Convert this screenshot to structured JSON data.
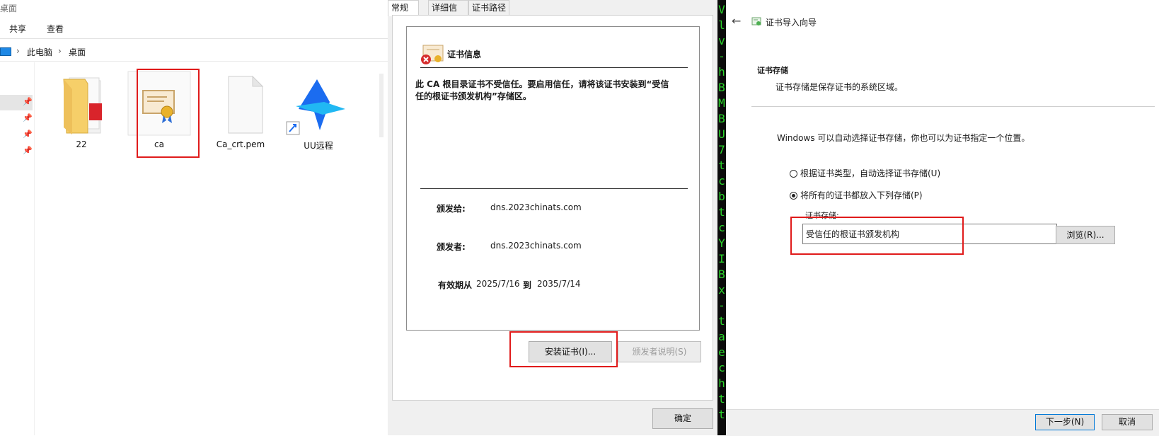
{
  "explorer": {
    "title": "桌面",
    "ribbon_tabs": [
      "共享",
      "查看"
    ],
    "breadcrumb": [
      "此电脑",
      "桌面"
    ],
    "files": [
      {
        "name": "22",
        "icon": "folder-icon"
      },
      {
        "name": "ca",
        "icon": "certificate-icon"
      },
      {
        "name": "Ca_crt.pem",
        "icon": "blank-file-icon"
      },
      {
        "name": "UU远程",
        "icon": "uu-remote-app-icon"
      }
    ]
  },
  "cert_dialog": {
    "tabs": [
      "常规",
      "详细信息",
      "证书路径"
    ],
    "heading": "证书信息",
    "warning_line1": "此 CA 根目录证书不受信任。要启用信任，请将该证书安装到“受信",
    "warning_line2": "任的根证书颁发机构”存储区。",
    "issued_to_label": "颁发给:",
    "issued_to_value": "dns.2023chinats.com",
    "issued_by_label": "颁发者:",
    "issued_by_value": "dns.2023chinats.com",
    "valid_from_label": "有效期从",
    "valid_from": "2025/7/16",
    "valid_to_label": "到",
    "valid_to": "2035/7/14",
    "install_button": "安装证书(I)...",
    "issuer_statement_button": "颁发者说明(S)",
    "ok_button": "确定"
  },
  "terminal": {
    "chars": [
      "V",
      "l",
      "v",
      "-",
      "h",
      "B",
      "M",
      "B",
      "U",
      "7",
      "t",
      "c",
      "b",
      "t",
      "c",
      "Y",
      "I",
      "B",
      "x",
      "-",
      "t",
      "a",
      "e",
      "c",
      "h",
      "t",
      "t"
    ],
    "color": "#2ad52a"
  },
  "wizard": {
    "title": "证书导入向导",
    "section_title": "证书存储",
    "section_desc": "证书存储是保存证书的系统区域。",
    "intro": "Windows 可以自动选择证书存储，你也可以为证书指定一个位置。",
    "option_auto": "根据证书类型，自动选择证书存储(U)",
    "option_manual": "将所有的证书都放入下列存储(P)",
    "store_label": "证书存储:",
    "store_value": "受信任的根证书颁发机构",
    "browse_button": "浏览(R)...",
    "next_button": "下一步(N)",
    "cancel_button": "取消"
  },
  "colors": {
    "highlight_box": "#e01b1b",
    "accent": "#0078d7"
  }
}
